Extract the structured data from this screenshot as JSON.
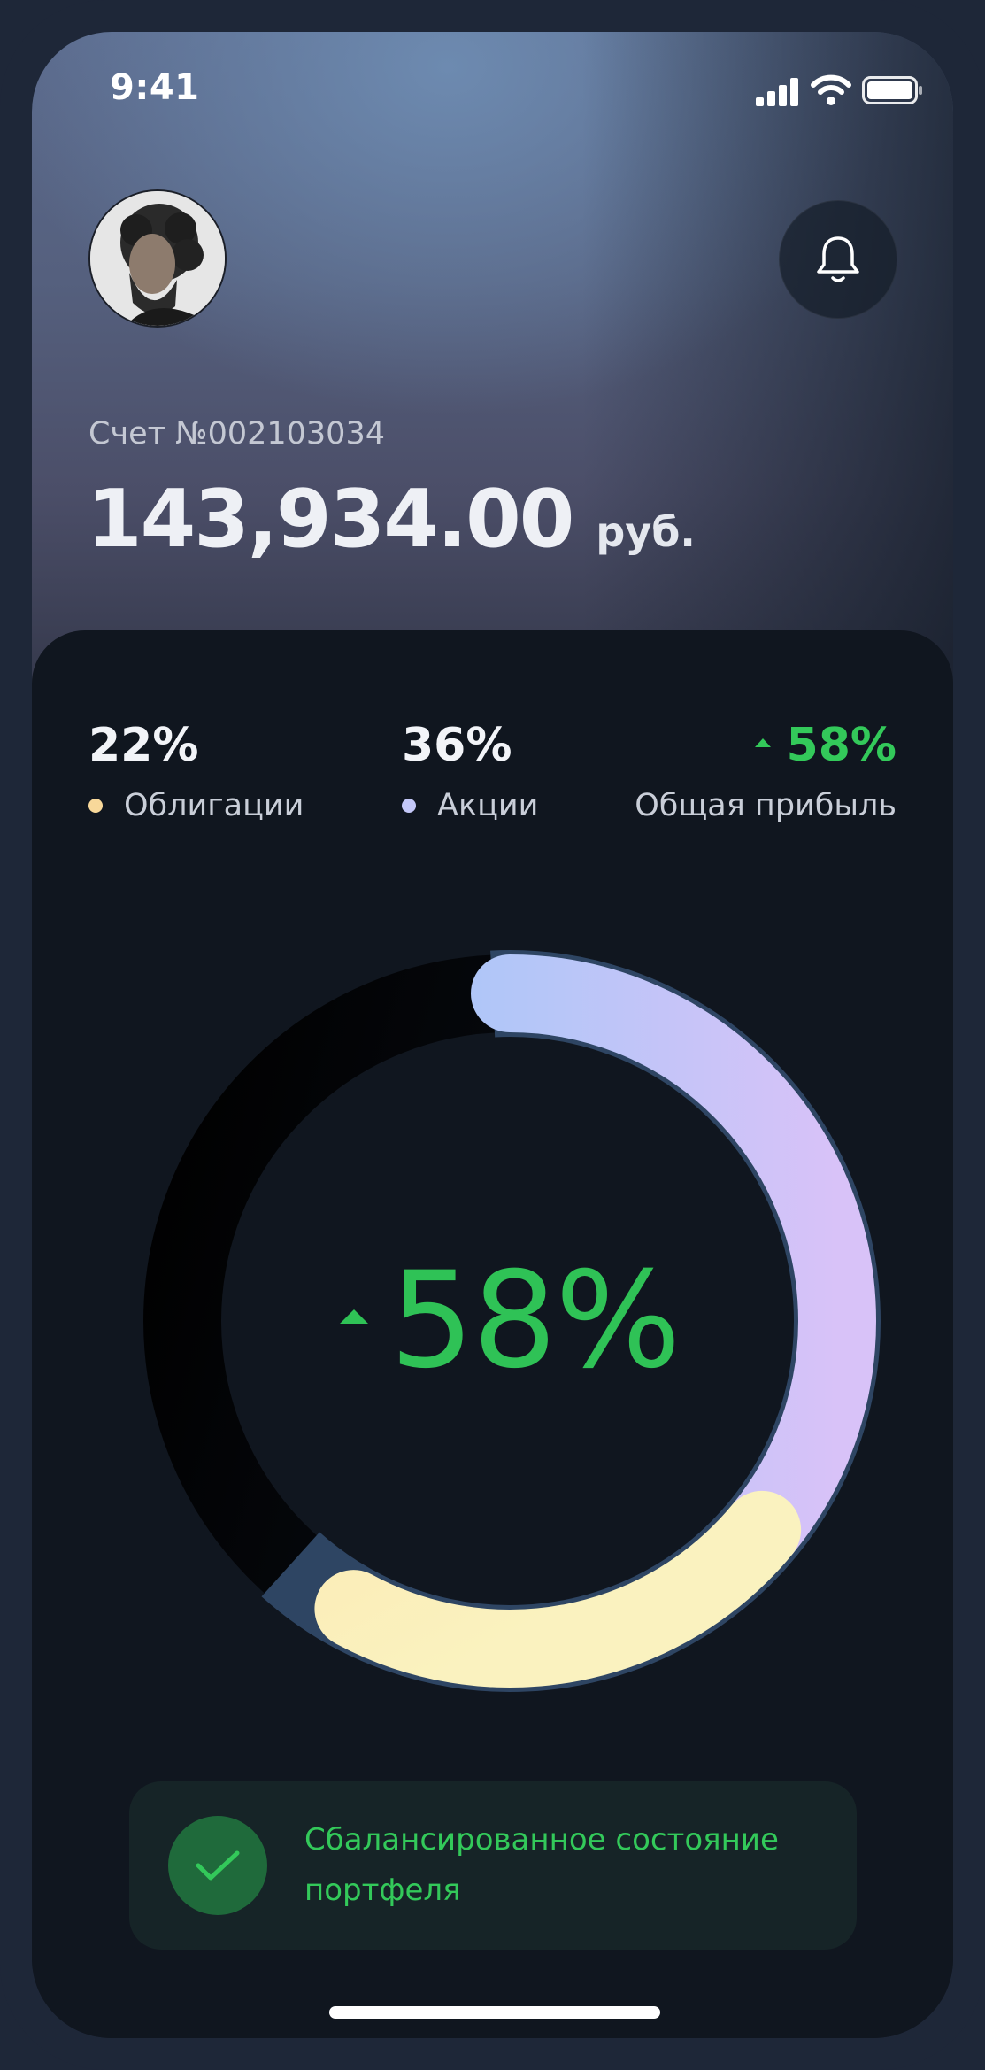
{
  "status_bar": {
    "time": "9:41",
    "icons": [
      "signal-icon",
      "wifi-icon",
      "battery-icon"
    ]
  },
  "header": {
    "avatar": "user-avatar",
    "notification_icon": "bell-icon",
    "account_label": "Счет №002103034",
    "balance_amount": "143,934.00",
    "balance_currency": "руб."
  },
  "stats": {
    "bonds": {
      "value": "22%",
      "label": "Облигации",
      "color": "#f8d89a"
    },
    "stocks": {
      "value": "36%",
      "label": "Акции",
      "color": "#c4c8f8"
    },
    "profit": {
      "value": "58%",
      "label": "Общая прибыль",
      "color": "#33c95a",
      "trend": "up"
    }
  },
  "chart_data": {
    "type": "pie",
    "style": "donut",
    "center_label": "58%",
    "center_trend": "up",
    "segments": [
      {
        "name": "Облигации",
        "value": 22,
        "colors": [
          "#fdc48a",
          "#fbf0bb"
        ]
      },
      {
        "name": "Акции",
        "value": 36,
        "colors": [
          "#96c8fa",
          "#d6c4f8"
        ]
      }
    ]
  },
  "status_message": {
    "text": "Сбалансированное состояние портфеля",
    "icon": "check-icon",
    "color": "#33c95a"
  }
}
